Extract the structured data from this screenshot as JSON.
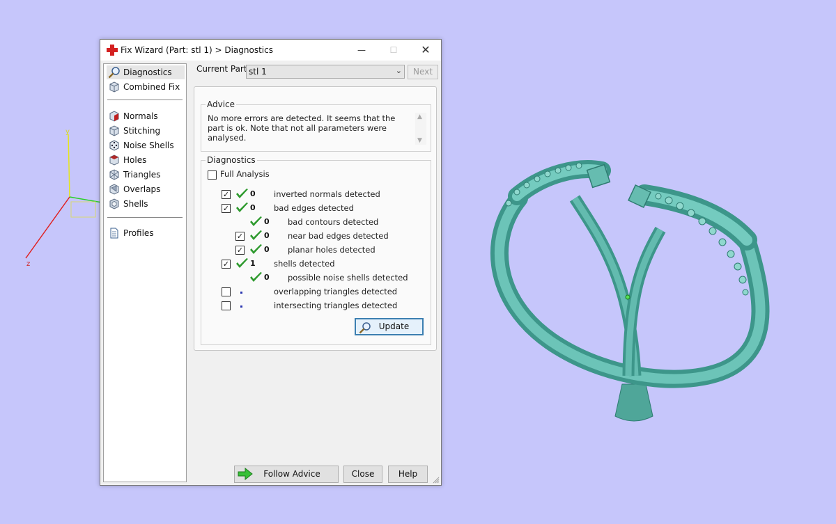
{
  "window": {
    "title": "Fix Wizard (Part: stl 1) > Diagnostics",
    "controls": {
      "minimize": "—",
      "maximize": "☐",
      "close": "✕"
    }
  },
  "sidebar": {
    "items": [
      {
        "label": "Diagnostics",
        "icon": "magnifier-icon",
        "selected": true
      },
      {
        "label": "Combined Fix",
        "icon": "cube-icon"
      },
      {
        "label": "Normals",
        "icon": "cube-red-face-icon"
      },
      {
        "label": "Stitching",
        "icon": "cube-icon"
      },
      {
        "label": "Noise Shells",
        "icon": "dice-icon"
      },
      {
        "label": "Holes",
        "icon": "cube-hole-icon"
      },
      {
        "label": "Triangles",
        "icon": "triangle-mesh-icon"
      },
      {
        "label": "Overlaps",
        "icon": "overlap-icon"
      },
      {
        "label": "Shells",
        "icon": "shell-icon"
      },
      {
        "label": "Profiles",
        "icon": "document-icon"
      }
    ]
  },
  "current_part": {
    "label": "Current Part:",
    "value": "stl 1"
  },
  "next_button": {
    "label": "Next",
    "enabled": false
  },
  "advice": {
    "title": "Advice",
    "text": "No more errors are detected. It seems that the part is ok. Note that not all parameters were analysed."
  },
  "diagnostics": {
    "title": "Diagnostics",
    "full_analysis": {
      "label": "Full Analysis",
      "checked": false
    },
    "rows": [
      {
        "checkbox": true,
        "checked": true,
        "status": "ok",
        "count": "0",
        "label": "inverted normals detected",
        "indent": 0
      },
      {
        "checkbox": true,
        "checked": true,
        "status": "ok",
        "count": "0",
        "label": "bad edges detected",
        "indent": 0
      },
      {
        "checkbox": false,
        "checked": false,
        "status": "ok",
        "count": "0",
        "label": "bad contours detected",
        "indent": 1
      },
      {
        "checkbox": true,
        "checked": true,
        "status": "ok",
        "count": "0",
        "label": "near bad edges detected",
        "indent": 1
      },
      {
        "checkbox": true,
        "checked": true,
        "status": "ok",
        "count": "0",
        "label": "planar holes detected",
        "indent": 1
      },
      {
        "checkbox": true,
        "checked": true,
        "status": "ok",
        "count": "1",
        "label": "shells detected",
        "indent": 0
      },
      {
        "checkbox": false,
        "checked": false,
        "status": "ok",
        "count": "0",
        "label": "possible noise shells detected",
        "indent": 1
      },
      {
        "checkbox": true,
        "checked": false,
        "status": "pending",
        "count": "",
        "label": "overlapping triangles detected",
        "indent": 0
      },
      {
        "checkbox": true,
        "checked": false,
        "status": "pending",
        "count": "",
        "label": "intersecting triangles detected",
        "indent": 0
      }
    ],
    "update_button": "Update"
  },
  "footer": {
    "follow_advice": "Follow Advice",
    "close": "Close",
    "help": "Help"
  },
  "viewport": {
    "axis_labels": {
      "y": "y",
      "z": "z"
    },
    "model": "ring",
    "colors": {
      "background": "#c6c6fb",
      "model": "#5fb8ac",
      "axis_x": "#2bd02b",
      "axis_y": "#e6e61a",
      "axis_z": "#e02020"
    }
  }
}
